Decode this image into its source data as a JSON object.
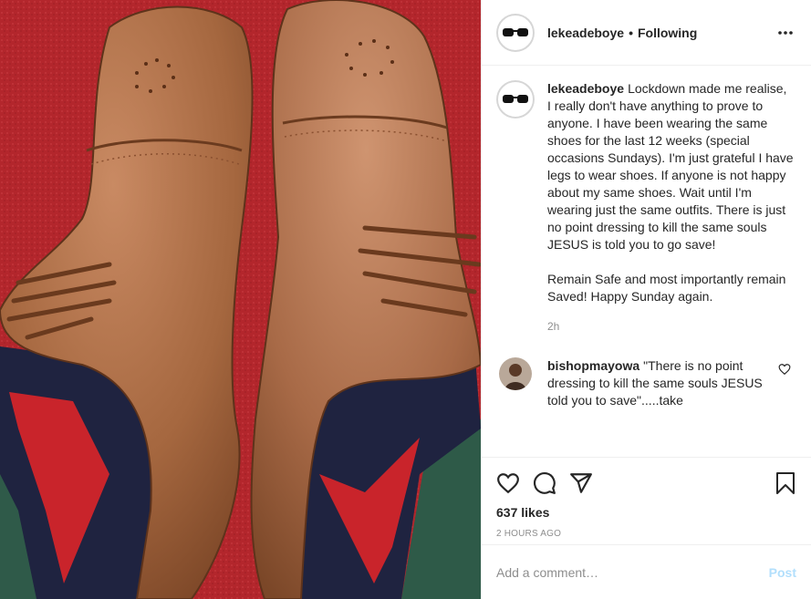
{
  "header": {
    "username": "lekeadeboye",
    "separator": "•",
    "follow_status": "Following",
    "more_icon": "more-horizontal-icon"
  },
  "caption": {
    "username": "lekeadeboye",
    "text_p1": "Lockdown made me realise, I really don't have anything to prove to anyone. I have been wearing the same shoes for the last 12 weeks (special occasions Sundays). I'm just grateful I have legs to wear shoes. If anyone is not happy about my same shoes. Wait until I'm wearing just the same outfits. There is just no point dressing to kill the same souls JESUS is told you to go save!",
    "text_p2": "Remain Safe and most importantly remain Saved! Happy Sunday again.",
    "time": "2h"
  },
  "comments": [
    {
      "username": "bishopmayowa",
      "text": "\"There is no point dressing to kill the same souls JESUS told you to save\".....take"
    }
  ],
  "actions": {
    "like_icon": "heart-icon",
    "comment_icon": "comment-icon",
    "share_icon": "share-icon",
    "save_icon": "bookmark-icon",
    "likes": "637 likes",
    "date": "2 HOURS AGO"
  },
  "add_comment": {
    "placeholder": "Add a comment…",
    "post_label": "Post"
  },
  "colors": {
    "carpet": "#b3262c",
    "shoe": "#a86a47",
    "sock": "#1f2340",
    "post_button": "#b2dffc",
    "muted": "#8e8e8e"
  }
}
